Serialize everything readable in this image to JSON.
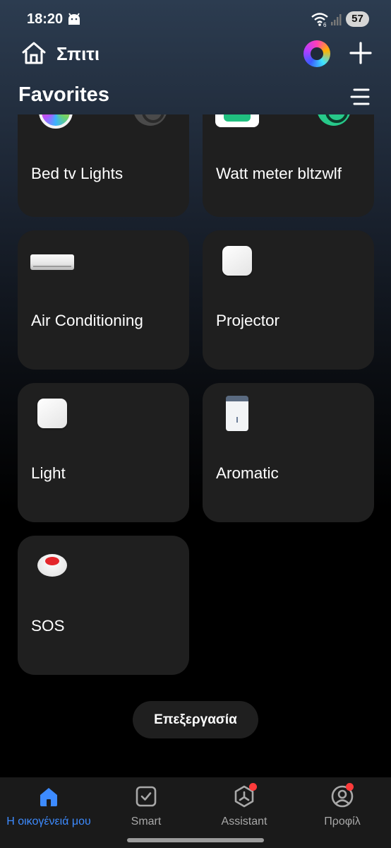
{
  "status_bar": {
    "time": "18:20",
    "battery": "57"
  },
  "header": {
    "home_title": "Σπιτι",
    "section_title": "Favorites"
  },
  "devices": [
    {
      "name": "Bed tv Lights",
      "image": "rgb-bulb"
    },
    {
      "name": "Watt meter bltzwlf",
      "image": "smart-plug"
    },
    {
      "name": "Air Conditioning",
      "image": "air-conditioner"
    },
    {
      "name": "Projector",
      "image": "white-square-device"
    },
    {
      "name": "Light",
      "image": "white-square-device"
    },
    {
      "name": "Aromatic",
      "image": "diffuser"
    },
    {
      "name": "SOS",
      "image": "sos-button"
    }
  ],
  "edit_button": "Επεξεργασία",
  "nav": [
    {
      "label": "Η οικογένειά μου",
      "icon": "home-icon",
      "active": true
    },
    {
      "label": "Smart",
      "icon": "checkbox-icon",
      "active": false
    },
    {
      "label": "Assistant",
      "icon": "assistant-icon",
      "active": false,
      "badge": true
    },
    {
      "label": "Προφίλ",
      "icon": "profile-icon",
      "active": false,
      "badge": true
    }
  ],
  "colors": {
    "accent": "#3d8bff",
    "card": "#1f1f1f",
    "badge": "#ff3b3b",
    "toggle_on": "#27c98a"
  }
}
